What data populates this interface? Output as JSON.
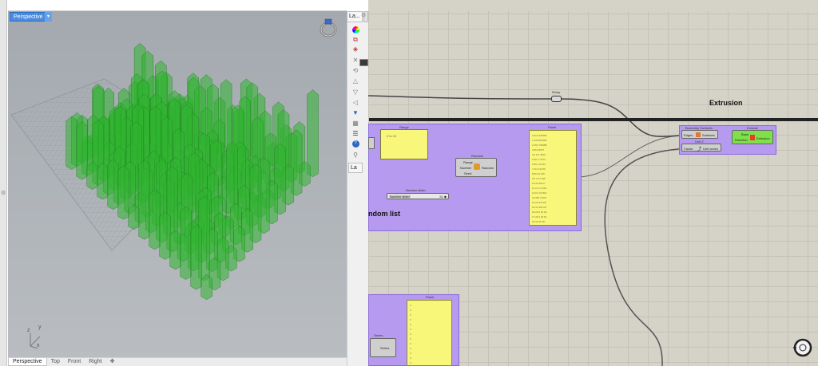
{
  "viewport": {
    "active_tab": "Perspective",
    "view_tabs": [
      "Perspective",
      "Top",
      "Front",
      "Right"
    ],
    "add_tab_icon": "plus-icon",
    "axis_labels": {
      "x": "x",
      "y": "y",
      "z": "z"
    }
  },
  "panel": {
    "tab_label": "La...",
    "bottom_tab_label": "La",
    "icons": [
      "color-wheel-icon",
      "layer-icon",
      "hide-icon",
      "close-icon",
      "undo-icon",
      "up-icon",
      "down-icon",
      "left-icon",
      "filter-icon",
      "grid-icon",
      "list-icon",
      "help-icon",
      "zoom-icon"
    ]
  },
  "canvas": {
    "relay_label": "Relay",
    "extrusion_label": "Extrusion",
    "random_list_label": "ndom list",
    "range_group_title": "Range",
    "range_value": "0 to 10",
    "random_group_title": "Random",
    "random_inputs": [
      "Range",
      "Number",
      "Seed"
    ],
    "random_output": "Random",
    "number_slider_title": "Number slider",
    "number_slider_label": "Number slider",
    "number_slider_value": "51 ◆",
    "panel_title": "Panel",
    "panel_values": [
      "0.315 446556",
      "1.036 813583",
      "2.153 736388",
      "3.36 46797",
      "4.3 8 6 4000",
      "5.26 4 70 64",
      "6.36 4 03 64",
      "7.31 6 33 56",
      "8.66 33 156",
      "9.5 1 57 665",
      "10.33 303 6",
      "11.3 4 5 1213",
      "12.8 4 03 813",
      "13.366 3 065",
      "14.26 43 606",
      "15.33 303 68",
      "16.28 4 30 64",
      "17.36 4 03 64",
      "18.32 61 58"
    ],
    "boundary_group_title": "Boundary Surfaces",
    "boundary_inputs": [
      "Edges"
    ],
    "boundary_output": "Surfaces",
    "unit_z_title": "Unit Z",
    "unit_z_inputs": [
      "Factor"
    ],
    "unit_z_output": "Unit vector",
    "extrude_group_title": "Extrude",
    "extrude_inputs": [
      "Base",
      "Direction"
    ],
    "extrude_output": "Extrusion",
    "lower_panel_title": "Panel",
    "lower_panel_values": [
      "0",
      "0",
      "0",
      "0",
      "0",
      "0",
      "0",
      "0",
      "0",
      "0",
      "0",
      "0",
      "0",
      "0",
      "0"
    ],
    "series_title": "Series",
    "series_label": "Series",
    "navigator_icon": "navigation-widget-icon"
  },
  "colors": {
    "group_fill": "#b69af0",
    "panel_fill": "#f9f77a",
    "canvas_bg": "#d5d2c8",
    "extrusion_green": "#2fb52f",
    "tab_blue": "#4a8be0"
  }
}
